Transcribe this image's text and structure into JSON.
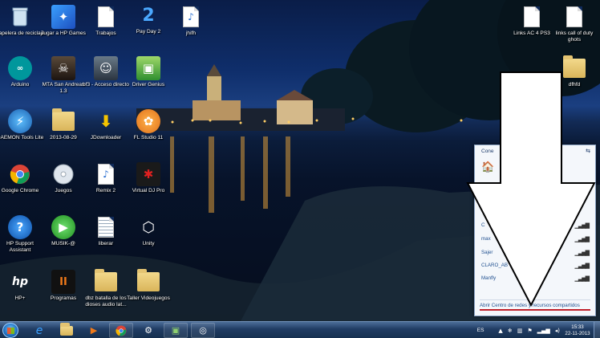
{
  "desktop": {
    "icons": [
      {
        "label": "Papelera de reciclaje",
        "icon": "recycle-bin-icon"
      },
      {
        "label": "Jugar a HP Games",
        "icon": "hp-games-icon"
      },
      {
        "label": "Trabajos",
        "icon": "document-shortcut-icon"
      },
      {
        "label": "Pay Day 2",
        "icon": "payday2-icon"
      },
      {
        "label": "jhifh",
        "icon": "audio-file-icon"
      },
      {
        "label": "Arduino",
        "icon": "arduino-icon"
      },
      {
        "label": "MTA San Andreas 1.3",
        "icon": "mta-icon"
      },
      {
        "label": "bf3 - Acceso directo",
        "icon": "bf3-icon"
      },
      {
        "label": "Driver Genius",
        "icon": "driver-genius-icon"
      },
      {
        "label": "DAEMON Tools Lite",
        "icon": "daemon-tools-icon"
      },
      {
        "label": "2013-08-29",
        "icon": "folder-icon"
      },
      {
        "label": "JDownloader",
        "icon": "jdownloader-icon"
      },
      {
        "label": "FL Studio 11",
        "icon": "fl-studio-icon"
      },
      {
        "label": "Google Chrome",
        "icon": "chrome-icon"
      },
      {
        "label": "Juegos",
        "icon": "disc-icon"
      },
      {
        "label": "Remix  2",
        "icon": "audio-file-icon"
      },
      {
        "label": "Virtual DJ Pro",
        "icon": "virtual-dj-icon"
      },
      {
        "label": "HP Support Assistant",
        "icon": "help-icon"
      },
      {
        "label": "MUSIK-@",
        "icon": "play-icon"
      },
      {
        "label": "liberar",
        "icon": "text-file-icon"
      },
      {
        "label": "Unity",
        "icon": "unity-icon"
      },
      {
        "label": "HP+",
        "icon": "hp-icon"
      },
      {
        "label": "Programas",
        "icon": "black-ops-icon"
      },
      {
        "label": "dbz batalla de los dioses audio lat...",
        "icon": "folder-icon"
      },
      {
        "label": "Taller Videojuegos",
        "icon": "folder-icon"
      },
      {
        "label": "Links AC 4 PS3",
        "icon": "text-file-icon"
      },
      {
        "label": "links call of duty ghots",
        "icon": "text-file-icon"
      },
      {
        "label": "dfhfd",
        "icon": "folder-icon"
      }
    ]
  },
  "network_panel": {
    "title": "Cone",
    "networks": [
      {
        "name": "C"
      },
      {
        "name": "max"
      },
      {
        "name": "Sajer"
      },
      {
        "name": "CLARO_AB"
      },
      {
        "name": "Manfly"
      }
    ],
    "footer_link": "Abrir Centro de redes y recursos compartidos"
  },
  "taskbar": {
    "language": "ES",
    "clock_time": "15:33",
    "clock_date": "22-11-2013"
  },
  "colors": {
    "accent_red": "#c0202a",
    "link_blue": "#1f4f8f"
  }
}
